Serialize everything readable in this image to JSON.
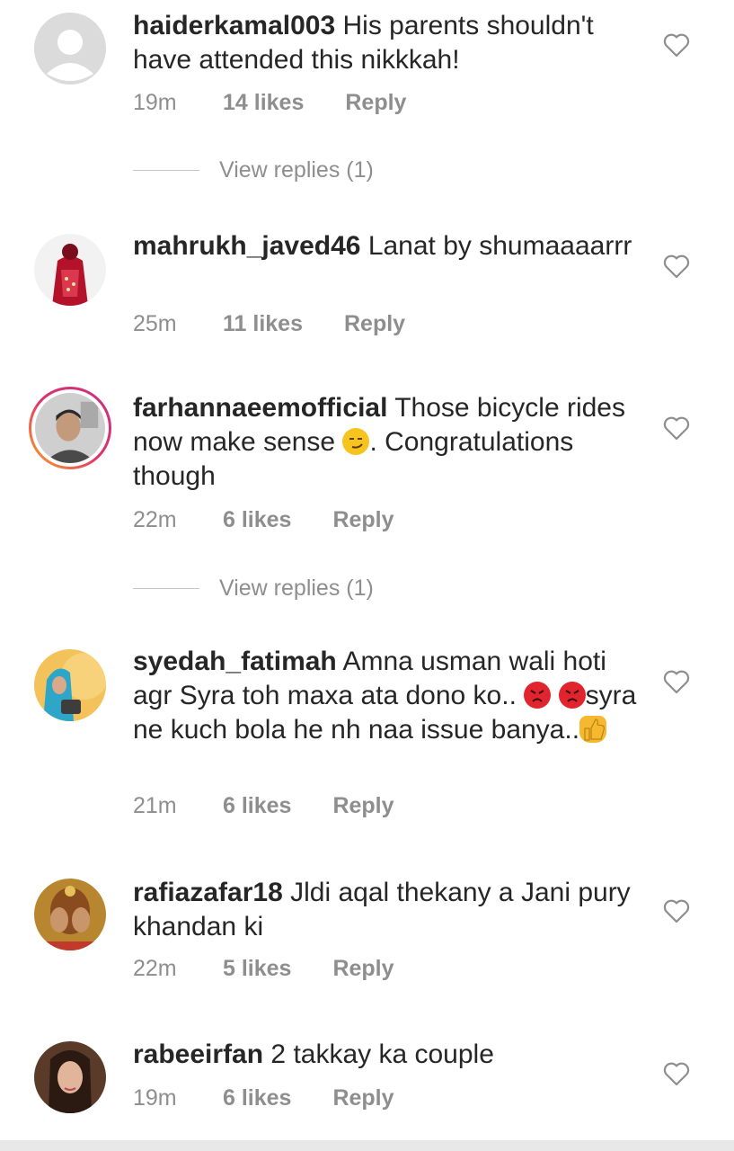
{
  "comments": [
    {
      "username": "haiderkamal003",
      "text": "His parents shouldn't have attended this nikkkah!",
      "time": "19m",
      "likes": "14 likes",
      "reply": "Reply",
      "view_replies": "View replies (1)",
      "avatar": "default-avatar-icon"
    },
    {
      "username": "mahrukh_javed46",
      "text": "Lanat by shumaaaarrr",
      "time": "25m",
      "likes": "11 likes",
      "reply": "Reply",
      "avatar": "red-dress-photo"
    },
    {
      "username": "farhannaeemofficial",
      "text_part1": "Those bicycle rides now make sense",
      "text_part2": ". Congratulations though",
      "time": "22m",
      "likes": "6 likes",
      "reply": "Reply",
      "view_replies": "View replies (1)",
      "avatar": "man-portrait-photo"
    },
    {
      "username": "syedah_fatimah",
      "text_part1": "Amna usman wali hoti agr Syra toh maxa ata dono ko..",
      "text_part2": "syra ne kuch bola he nh naa issue banya..",
      "time": "21m",
      "likes": "6 likes",
      "reply": "Reply",
      "avatar": "woman-hijab-photo"
    },
    {
      "username": "rafiazafar18",
      "text": "Jldi aqal thekany a Jani pury khandan ki",
      "time": "22m",
      "likes": "5 likes",
      "reply": "Reply",
      "avatar": "bride-hands-photo"
    },
    {
      "username": "rabeeirfan",
      "text": "2 takkay ka couple",
      "time": "19m",
      "likes": "6 likes",
      "reply": "Reply",
      "avatar": "woman-portrait-photo"
    }
  ],
  "colors": {
    "text": "#262626",
    "meta": "#8e8e8e",
    "ring_gradient": [
      "#f9a825",
      "#e1306c",
      "#c13584"
    ]
  },
  "icons": {
    "like": "heart-outline-icon",
    "emojis": [
      "smirk-emoji",
      "angry-face-emoji",
      "thumbs-up-emoji"
    ]
  }
}
